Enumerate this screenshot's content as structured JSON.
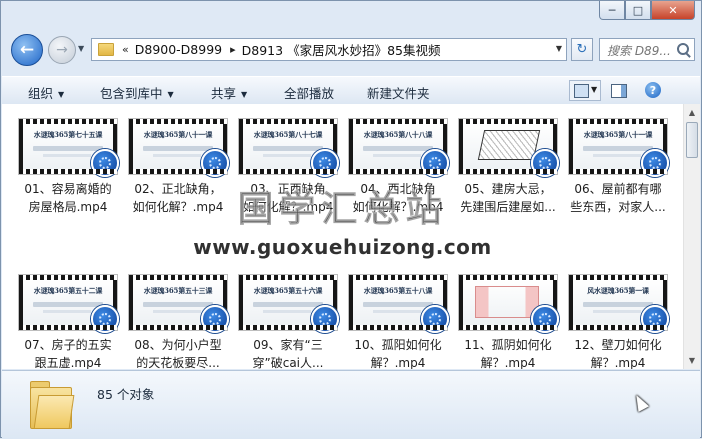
{
  "window": {
    "caption_buttons": {
      "minimize": "─",
      "maximize": "□",
      "close": "✕"
    }
  },
  "nav": {
    "back_glyph": "←",
    "forward_glyph": "→",
    "dropdown_glyph": "▼",
    "address": {
      "overflow": "«",
      "separator": "▸",
      "crumbs": [
        "D8900-D8999",
        "D8913 《家居风水妙招》85集视频"
      ]
    },
    "refresh_glyph": "↻",
    "search_placeholder": "搜索 D89..."
  },
  "toolbar": {
    "organize": "组织",
    "include_in_library": "包含到库中",
    "share": "共享",
    "play_all": "全部播放",
    "new_folder": "新建文件夹",
    "caret": "▼",
    "help_glyph": "?"
  },
  "files": [
    {
      "line1": "01、容易离婚的",
      "line2": "房屋格局.mp4",
      "frame_title": "水谜瑰365第七十五课"
    },
    {
      "line1": "02、正北缺角，",
      "line2": "如何化解？.mp4",
      "frame_title": "水谜瑰365第八十一课"
    },
    {
      "line1": "03、正西缺角",
      "line2": "如何化解？.mp4",
      "frame_title": "水谜瑰365第八十七课"
    },
    {
      "line1": "04、西北缺角",
      "line2": "如何化解？.mp4",
      "frame_title": "水谜瑰365第八十八课"
    },
    {
      "line1": "05、建房大忌，",
      "line2": "先建围后建屋如...",
      "frame_title": ""
    },
    {
      "line1": "06、屋前都有哪",
      "line2": "些东西，对家人...",
      "frame_title": "水谜瑰365第八十一课"
    },
    {
      "line1": "07、房子的五实",
      "line2": "跟五虚.mp4",
      "frame_title": "水谜瑰365第五十二课"
    },
    {
      "line1": "08、为何小户型",
      "line2": "的天花板要尽...",
      "frame_title": "水谜瑰365第五十三课"
    },
    {
      "line1": "09、家有“三",
      "line2": "穿”破cai人...",
      "frame_title": "水谜瑰365第五十六课"
    },
    {
      "line1": "10、孤阳如何化",
      "line2": "解？.mp4",
      "frame_title": "水谜瑰365第五十八课"
    },
    {
      "line1": "11、孤阴如何化",
      "line2": "解？.mp4",
      "frame_title": ""
    },
    {
      "line1": "12、壁刀如何化",
      "line2": "解？.mp4",
      "frame_title": "风水谜瑰365第一课"
    }
  ],
  "watermark": {
    "cn": "国学汇总站",
    "url": "www.guoxuehuizong.com"
  },
  "scrollbar": {
    "up": "▲",
    "down": "▼"
  },
  "details": {
    "count_text": "85 个对象"
  }
}
